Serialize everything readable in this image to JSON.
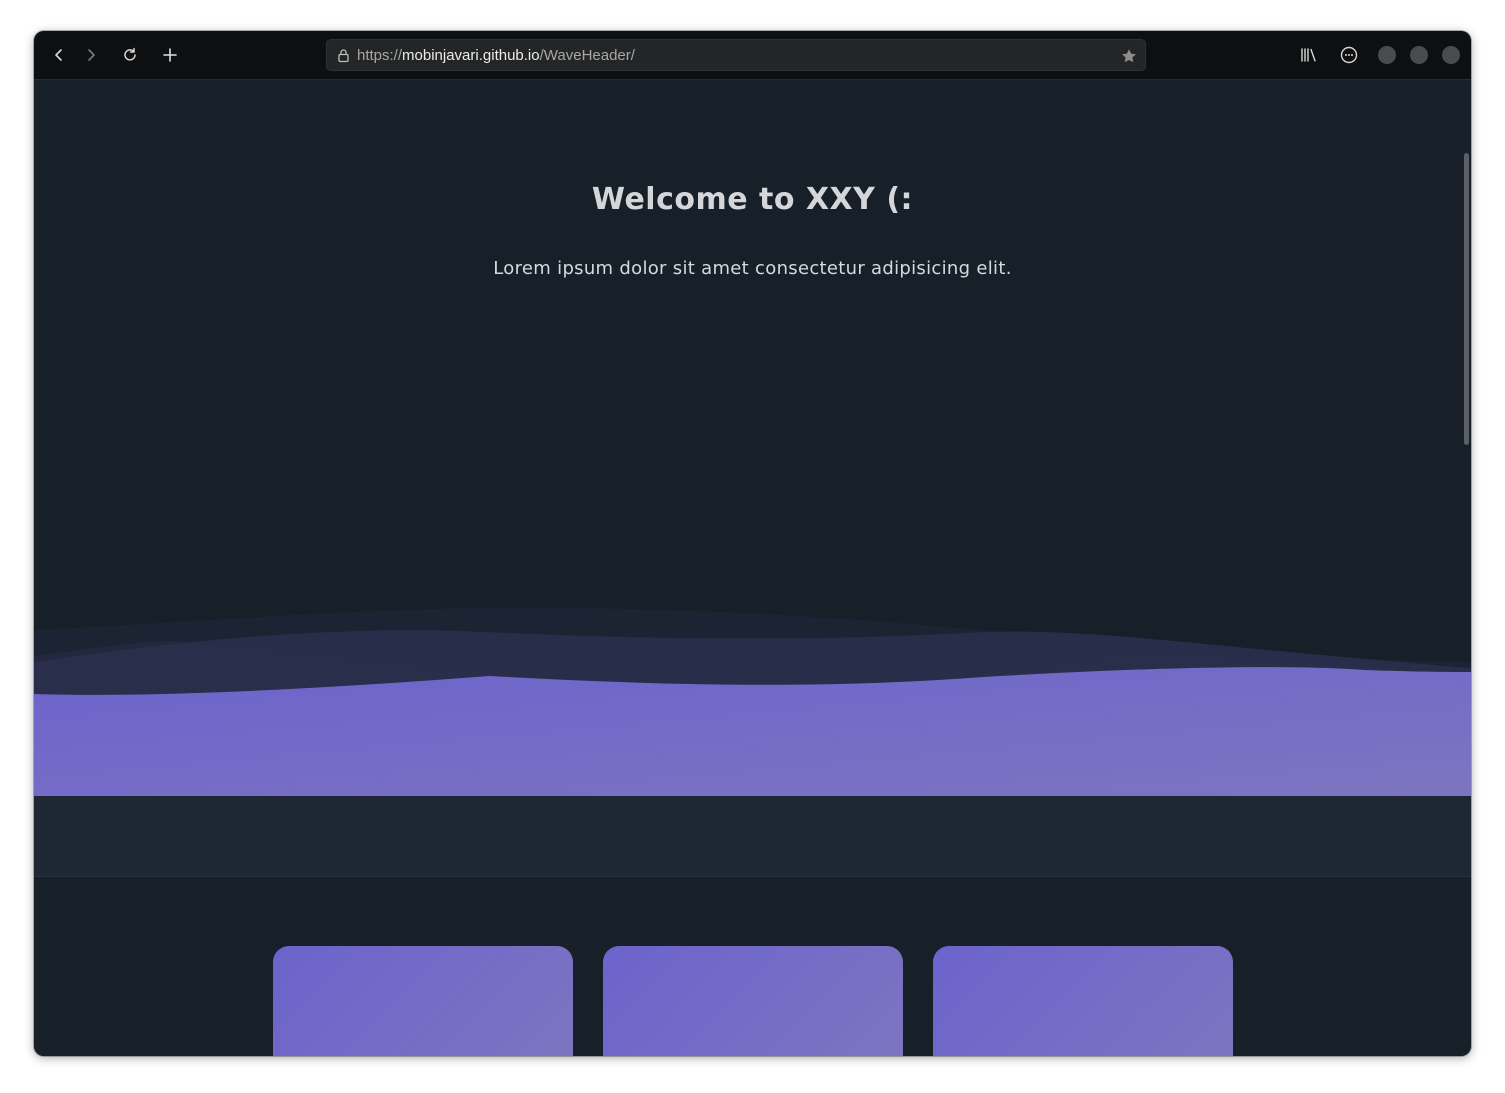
{
  "browser": {
    "url_scheme": "https://",
    "url_host": "mobinjavari.github.io",
    "url_path": "/WaveHeader/",
    "icons": [
      "back-icon",
      "forward-icon",
      "reload-icon",
      "new-tab-icon",
      "lock-icon",
      "bookmark-star-icon",
      "library-icon",
      "account-icon"
    ]
  },
  "hero": {
    "title": "Welcome to XXY (:",
    "subtitle": "Lorem ipsum dolor sit amet consectetur adipisicing elit."
  },
  "colors": {
    "page_background": "#171f29",
    "wave_gradient_start": "#6c63cc",
    "wave_gradient_end": "#7c75c0",
    "band_background": "#1e2835"
  },
  "cards": [
    {
      "id": "card-1"
    },
    {
      "id": "card-2"
    },
    {
      "id": "card-3"
    }
  ]
}
